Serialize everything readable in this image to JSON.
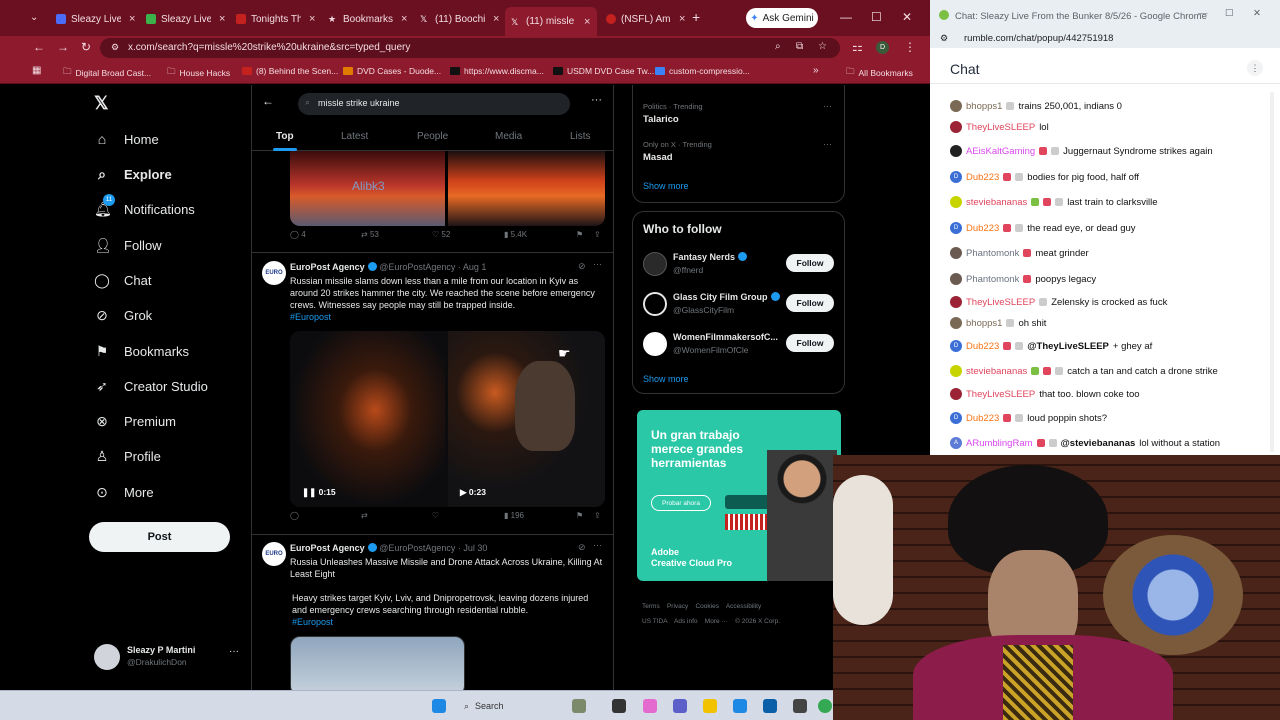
{
  "browser": {
    "tabs": [
      {
        "label": "Sleazy Live",
        "color": "#4a6cf7"
      },
      {
        "label": "Sleazy Live",
        "color": "#3cb34a"
      },
      {
        "label": "Tonights Th",
        "color": "#c5221f"
      },
      {
        "label": "Bookmarks",
        "color": "#f3dde2"
      },
      {
        "label": "(11) Boochi",
        "color": "#ffffff"
      },
      {
        "label": "(11) missle",
        "color": "#ffffff"
      },
      {
        "label": "(NSFL) Ame",
        "color": "#c5221f"
      }
    ],
    "gemini_label": "Ask Gemini",
    "url": "x.com/search?q=missle%20strike%20ukraine&src=typed_query",
    "bookmarks": [
      "Digital Broad Cast...",
      "House Hacks",
      "(8) Behind the Scen...",
      "DVD Cases - Duode...",
      "https://www.discma...",
      "USDM DVD Case Tw...",
      "custom-compressio..."
    ],
    "bookmarks_all": "All Bookmarks"
  },
  "x": {
    "nav": [
      {
        "label": "Home",
        "icon": "home-icon"
      },
      {
        "label": "Explore",
        "icon": "search-icon"
      },
      {
        "label": "Notifications",
        "icon": "bell-icon"
      },
      {
        "label": "Follow",
        "icon": "follow-icon"
      },
      {
        "label": "Chat",
        "icon": "chat-icon"
      },
      {
        "label": "Grok",
        "icon": "grok-icon"
      },
      {
        "label": "Bookmarks",
        "icon": "bookmark-icon"
      },
      {
        "label": "Creator Studio",
        "icon": "rocket-icon"
      },
      {
        "label": "Premium",
        "icon": "premium-icon"
      },
      {
        "label": "Profile",
        "icon": "person-icon"
      },
      {
        "label": "More",
        "icon": "more-icon"
      }
    ],
    "notif_count": "11",
    "post_label": "Post",
    "account": {
      "name": "Sleazy P Martini",
      "handle": "@DrakulichDon"
    },
    "search_query": "missle strike ukraine",
    "tabs": [
      "Top",
      "Latest",
      "People",
      "Media",
      "Lists"
    ],
    "prev_tweet": {
      "watermark": "Alibk3",
      "replies": "4",
      "reposts": "53",
      "likes": "52",
      "views": "5.4K"
    },
    "tweet1": {
      "name": "EuroPost Agency",
      "handle": "@EuroPostAgency",
      "date": "· Aug 1",
      "avatar_text": "EURO",
      "text": "Russian missile slams down less than a mile from our location in Kyiv as around 20 strikes hammer the city. We reached the scene before emergency crews. Witnesses say people may still be trapped inside.",
      "hashtag": "#Europost",
      "video1_time": "0:15",
      "video2_time": "0:23",
      "views": "196"
    },
    "tweet2": {
      "name": "EuroPost Agency",
      "handle": "@EuroPostAgency",
      "date": "· Jul 30",
      "avatar_text": "EURO",
      "text": "Russia Unleashes Massive Missile and Drone Attack Across Ukraine, Killing At Least Eight",
      "text2": "Heavy strikes target Kyiv, Lviv, and Dnipropetrovsk, leaving dozens injured and emergency crews searching through residential rubble.",
      "hashtag": "#Europost"
    },
    "trends": [
      {
        "meta": "Politics · Trending",
        "name": "Talarico"
      },
      {
        "meta": "Only on X · Trending",
        "name": "Masad"
      }
    ],
    "show_more": "Show more",
    "who_to_follow": "Who to follow",
    "follow_suggestions": [
      {
        "name": "Fantasy Nerds",
        "handle": "@ffnerd"
      },
      {
        "name": "Glass City Film Group",
        "handle": "@GlassCityFilm"
      },
      {
        "name": "WomenFilmmakersofC...",
        "handle": "@WomenFilmOfCle"
      }
    ],
    "follow_label": "Follow",
    "ad": {
      "headline": "Un gran trabajo merece grandes herramientas",
      "cta": "Probar ahora",
      "brand": "Adobe",
      "product": "Creative Cloud Pro"
    },
    "footer": [
      "Terms",
      "Privacy",
      "Cookies",
      "Accessibility",
      "US TIDA",
      "Ads info",
      "More ···",
      "© 2026 X Corp."
    ]
  },
  "chat": {
    "window_title": "Chat: Sleazy Live From the Bunker 8/5/26 - Google Chrome",
    "url": "rumble.com/chat/popup/442751918",
    "header": "Chat",
    "messages": [
      {
        "user": "bhopps1",
        "text": "trains 250,001, indians 0",
        "color": "#7a6a55"
      },
      {
        "user": "TheyLiveSLEEP",
        "text": "lol",
        "color": "#e0455d"
      },
      {
        "user": "AEisKaltGaming",
        "text": "Juggernaut Syndrome strikes again",
        "color": "#d946ef"
      },
      {
        "user": "Dub223",
        "text": "bodies for pig food, half off",
        "color": "#f97316"
      },
      {
        "user": "steviebananas",
        "text": "last train to clarksville",
        "color": "#e0455d"
      },
      {
        "user": "Dub223",
        "text": "the read eye, or dead guy",
        "color": "#f97316"
      },
      {
        "user": "Phantomonk",
        "text": "meat grinder",
        "color": "#6b7280"
      },
      {
        "user": "Phantomonk",
        "text": "poopys legacy",
        "color": "#6b7280"
      },
      {
        "user": "TheyLiveSLEEP",
        "text": "Zelensky is crocked as fuck",
        "color": "#e0455d"
      },
      {
        "user": "bhopps1",
        "text": "oh shit",
        "color": "#7a6a55"
      },
      {
        "user": "Dub223",
        "mention": "@TheyLiveSLEEP",
        "text": "+ ghey af",
        "color": "#f97316"
      },
      {
        "user": "steviebananas",
        "text": "catch a tan and catch a drone strike",
        "color": "#e0455d"
      },
      {
        "user": "TheyLiveSLEEP",
        "text": "that too. blown coke too",
        "color": "#e0455d"
      },
      {
        "user": "Dub223",
        "text": "loud poppin shots?",
        "color": "#f97316"
      },
      {
        "user": "ARumblingRam",
        "mention": "@steviebananas",
        "text": "lol without a station",
        "color": "#d946ef"
      }
    ]
  },
  "taskbar": {
    "search_label": "Search"
  }
}
